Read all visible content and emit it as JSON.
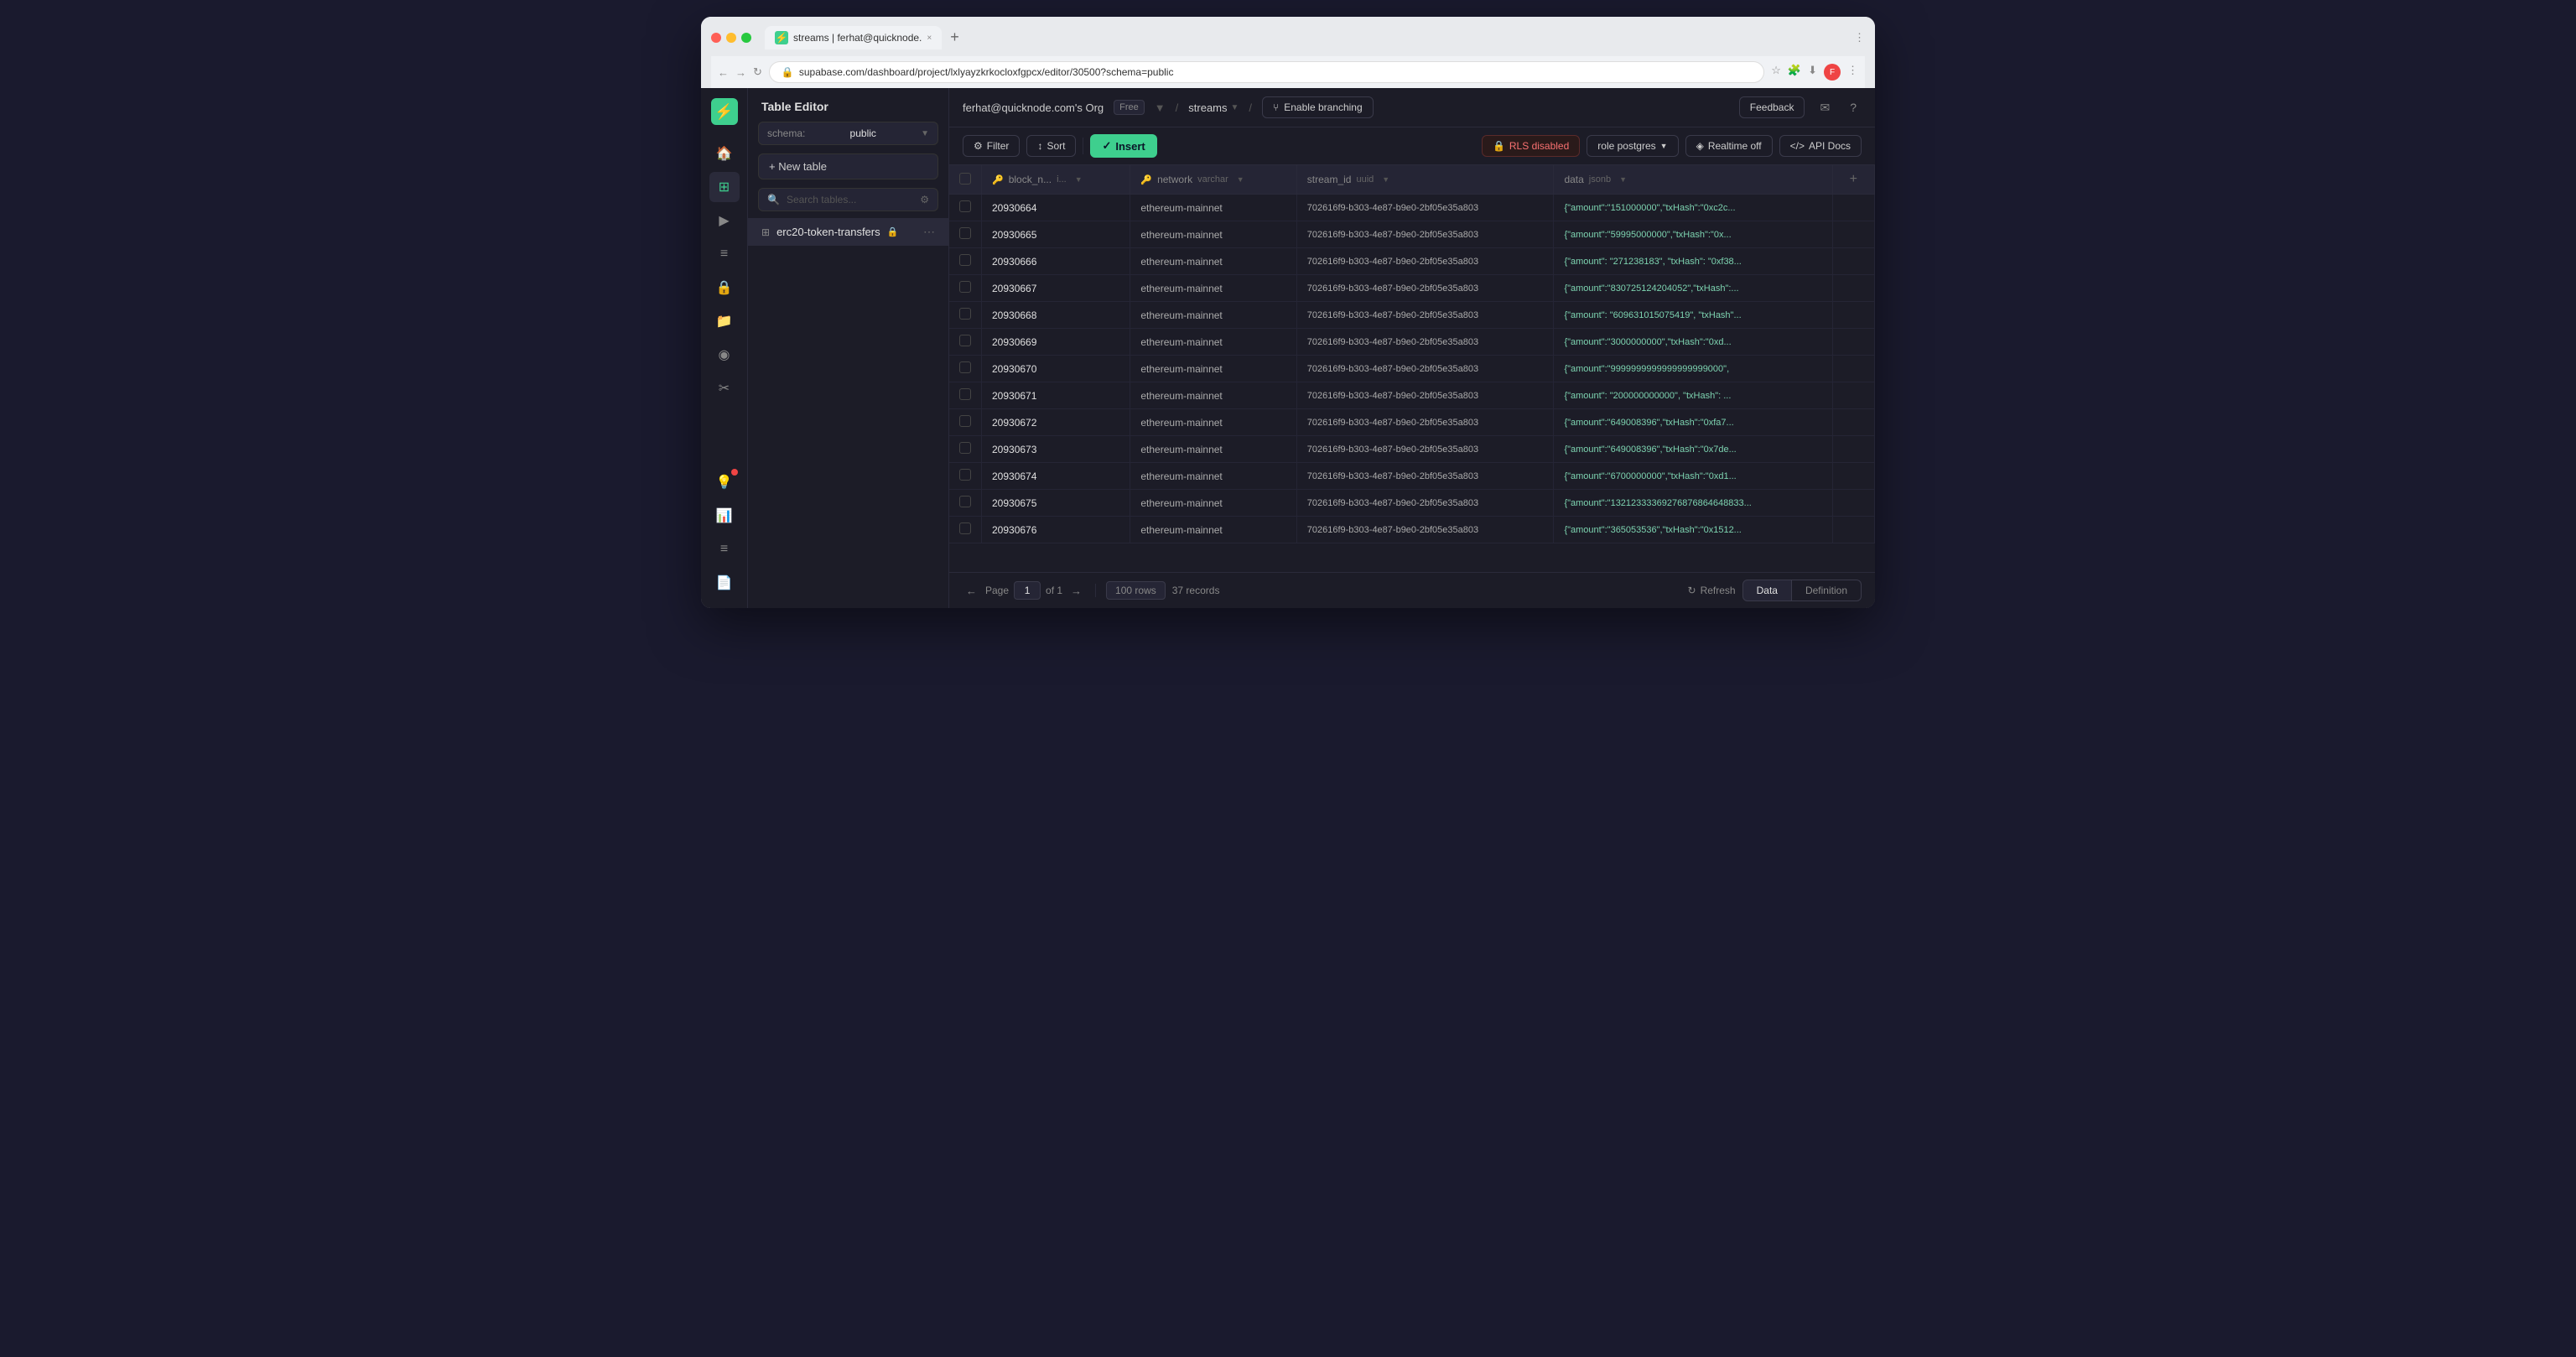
{
  "browser": {
    "url": "supabase.com/dashboard/project/lxlyayzkrkocloxfgpcx/editor/30500?schema=public",
    "tab_title": "streams | ferhat@quicknode.",
    "tab_close": "×",
    "new_tab": "+"
  },
  "app": {
    "title": "Table Editor",
    "brand_logo": "⚡",
    "org": {
      "name": "ferhat@quicknode.com's Org",
      "plan": "Free"
    },
    "breadcrumb": {
      "project": "streams",
      "separator": "/",
      "separator2": "/"
    },
    "enable_branching": "Enable branching",
    "feedback": "Feedback"
  },
  "sidebar": {
    "schema_label": "schema:",
    "schema_value": "public",
    "new_table_label": "+ New table",
    "search_placeholder": "Search tables...",
    "table_name": "erc20-token-transfers"
  },
  "toolbar": {
    "filter_label": "Filter",
    "sort_label": "Sort",
    "insert_label": "Insert",
    "rls_label": "RLS disabled",
    "role_label": "role  postgres",
    "realtime_label": "Realtime off",
    "api_docs_label": "API Docs"
  },
  "table": {
    "columns": [
      {
        "id": "block_n",
        "name": "block_n...",
        "icon": "🔑",
        "type": "i...",
        "sort": "▼"
      },
      {
        "id": "network",
        "name": "network",
        "icon": "",
        "type": "varchar",
        "sort": ""
      },
      {
        "id": "stream_id",
        "name": "stream_id",
        "icon": "",
        "type": "uuid",
        "sort": ""
      },
      {
        "id": "data",
        "name": "data",
        "icon": "",
        "type": "jsonb",
        "sort": "▼"
      }
    ],
    "rows": [
      {
        "block_num": "20930664",
        "network": "ethereum-mainnet",
        "stream_id": "702616f9-b303-4e87-b9e0-2bf05e35a803",
        "data": "{\"amount\":\"151000000\",\"txHash\":\"0xc2c..."
      },
      {
        "block_num": "20930665",
        "network": "ethereum-mainnet",
        "stream_id": "702616f9-b303-4e87-b9e0-2bf05e35a803",
        "data": "{\"amount\":\"59995000000\",\"txHash\":\"0x..."
      },
      {
        "block_num": "20930666",
        "network": "ethereum-mainnet",
        "stream_id": "702616f9-b303-4e87-b9e0-2bf05e35a803",
        "data": "{\"amount\": \"271238183\", \"txHash\": \"0xf38..."
      },
      {
        "block_num": "20930667",
        "network": "ethereum-mainnet",
        "stream_id": "702616f9-b303-4e87-b9e0-2bf05e35a803",
        "data": "{\"amount\":\"830725124204052\",\"txHash\":..."
      },
      {
        "block_num": "20930668",
        "network": "ethereum-mainnet",
        "stream_id": "702616f9-b303-4e87-b9e0-2bf05e35a803",
        "data": "{\"amount\": \"609631015075419\", \"txHash\"..."
      },
      {
        "block_num": "20930669",
        "network": "ethereum-mainnet",
        "stream_id": "702616f9-b303-4e87-b9e0-2bf05e35a803",
        "data": "{\"amount\":\"3000000000\",\"txHash\":\"0xd..."
      },
      {
        "block_num": "20930670",
        "network": "ethereum-mainnet",
        "stream_id": "702616f9-b303-4e87-b9e0-2bf05e35a803",
        "data": "{\"amount\":\"9999999999999999999000\","
      },
      {
        "block_num": "20930671",
        "network": "ethereum-mainnet",
        "stream_id": "702616f9-b303-4e87-b9e0-2bf05e35a803",
        "data": "{\"amount\": \"200000000000\", \"txHash\": ..."
      },
      {
        "block_num": "20930672",
        "network": "ethereum-mainnet",
        "stream_id": "702616f9-b303-4e87-b9e0-2bf05e35a803",
        "data": "{\"amount\":\"649008396\",\"txHash\":\"0xfa7..."
      },
      {
        "block_num": "20930673",
        "network": "ethereum-mainnet",
        "stream_id": "702616f9-b303-4e87-b9e0-2bf05e35a803",
        "data": "{\"amount\":\"649008396\",\"txHash\":\"0x7de..."
      },
      {
        "block_num": "20930674",
        "network": "ethereum-mainnet",
        "stream_id": "702616f9-b303-4e87-b9e0-2bf05e35a803",
        "data": "{\"amount\":\"6700000000\",\"txHash\":\"0xd1..."
      },
      {
        "block_num": "20930675",
        "network": "ethereum-mainnet",
        "stream_id": "702616f9-b303-4e87-b9e0-2bf05e35a803",
        "data": "{\"amount\":\"13212333369276876864648833..."
      },
      {
        "block_num": "20930676",
        "network": "ethereum-mainnet",
        "stream_id": "702616f9-b303-4e87-b9e0-2bf05e35a803",
        "data": "{\"amount\":\"365053536\",\"txHash\":\"0x1512..."
      }
    ]
  },
  "footer": {
    "page_label": "Page",
    "page_value": "1",
    "of_label": "of 1",
    "rows_label": "100 rows",
    "records_label": "37 records",
    "refresh_label": "Refresh",
    "data_tab": "Data",
    "definition_tab": "Definition"
  }
}
